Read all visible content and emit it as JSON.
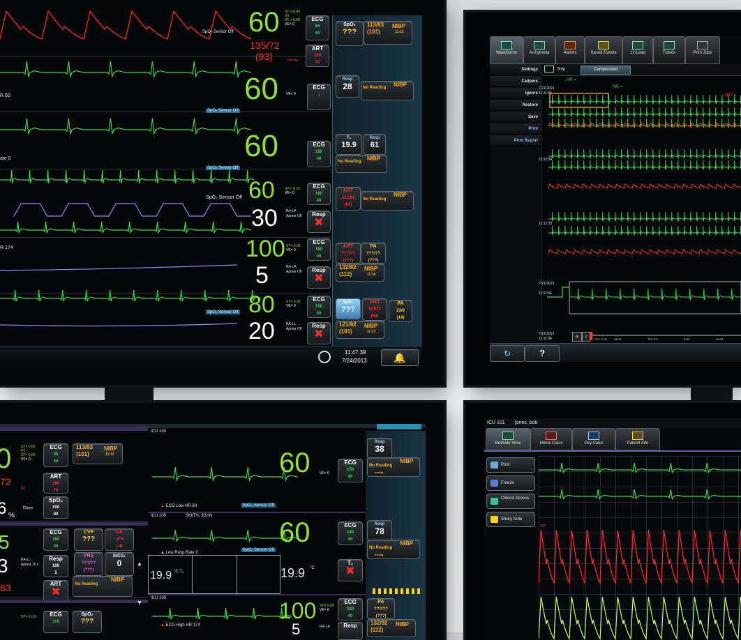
{
  "colors": {
    "ecg": "#3bd64b",
    "hr": "#8fe03a",
    "art": "#ff2b2b",
    "spo2": "#ffffff",
    "resp": "#9a86ff",
    "nibp": "#ffb000",
    "cvp": "#ffd21c"
  },
  "monitor_main": {
    "header": {
      "spo2_sensor_off": "SpO₂ Sensor Off"
    },
    "labels": {
      "hr_60": "R 60",
      "ate_0": "ate 0",
      "hr_174": "R 174"
    },
    "beds": [
      {
        "hr": "60",
        "st_label": "ST ≡ 0.00",
        "st_lead": "V3",
        "ve": "VE= 0",
        "ecg": "ECG",
        "ecg_hi": "85",
        "ecg_lo": "40",
        "art_value": "135/72",
        "art_mean": "(93)",
        "mmhg": "mmHg",
        "art": "ART",
        "art_hi": "160",
        "art_lo": "70",
        "spo2": "SpO₂",
        "spo2_val": "???",
        "nibp_value": "113/83",
        "nibp_mean": "(101)",
        "nibp": "NIBP",
        "nibp_time": "11:10"
      },
      {
        "hr": "60",
        "ve": "VE= 0",
        "ecg": "ECG",
        "resp": "Resp",
        "resp_val": "28",
        "no_reading": "No Reading",
        "nibp": "NIBP",
        "mmhg": "mmHg"
      },
      {
        "hr": "60",
        "ecg": "ECG",
        "t1": "T₁",
        "t1_val": "19.9",
        "resp": "Resp",
        "resp_val": "61",
        "no_reading": "No Reading",
        "nibp": "NIBP",
        "mmhg": "mmHg"
      },
      {
        "hr": "60",
        "rr": "30",
        "st": "ST= -0.16",
        "ve": "VE= 0",
        "ecg": "ECG",
        "lead": "RA-LA",
        "apnea": "Apnea Off",
        "resp": "Resp",
        "art": "ART",
        "art_val": "121/81",
        "art_mean": "(94)",
        "no_reading": "No Reading",
        "nibp": "NIBP",
        "mmhg": "mmHg"
      },
      {
        "hr": "100",
        "rr": "5",
        "st": "ST= 0.08",
        "ve": "VE= 0",
        "ecg": "ECG",
        "lead": "RA-LA",
        "apnea": "Apnea Off",
        "resp": "Resp",
        "art": "ART",
        "art_val": "???/??",
        "art_mean": "(???)",
        "pa": "PA",
        "pa_val": "???/??",
        "pa_mean": "(???)",
        "nibp_val": "132/92",
        "nibp_mean": "(112)",
        "nibp": "NIBP",
        "nibp_time": "11:16"
      },
      {
        "hr": "80",
        "rr": "20",
        "st": "ST= 0.08",
        "ve": "VE= 0",
        "ecg": "ECG",
        "lead": "RA-LL",
        "apnea": "Apnea Off",
        "resp": "Resp",
        "spo2": "SpO₂",
        "spo2_val": "???",
        "art": "ART",
        "art_val": "117/77",
        "art_mean": "(93)",
        "pa": "PA",
        "pa_val": "23/9",
        "pa_mean": "(14)",
        "nibp_val": "121/92",
        "nibp_mean": "(101)",
        "nibp": "NIBP",
        "nibp_time": "11:17"
      }
    ],
    "footer": {
      "time": "11:47:39",
      "date": "7/24/2013"
    }
  },
  "monitor_review": {
    "tabs": [
      "Waveforms",
      "Arrhythmia",
      "Alarms",
      "Saved Events",
      "12-Lead",
      "Trends",
      "Print Jobs"
    ],
    "subtabs": [
      "Strip",
      "Compressed"
    ],
    "buttons": [
      "Settings",
      "Calipers",
      "Ignore",
      "Restore",
      "Save",
      "Print",
      "Print Report"
    ],
    "hr_label": "HR =",
    "rr_label": "RR =",
    "art_label": "ART =",
    "rows": [
      {
        "date": "7/21/2013",
        "time": "11:11:34"
      },
      {
        "date": "",
        "time": "11:12:34"
      },
      {
        "date": "",
        "time": "11:12:33"
      }
    ],
    "strip_date": "7/21/2013",
    "strip_time": "11:11:34",
    "nav_date": "7/21/2013",
    "nav_time": "11:11:34",
    "nav_ticks": [
      "7/21 11:11",
      "16:00",
      "7/22 9:5",
      "8:00",
      "20:00"
    ],
    "help": "?"
  },
  "monitor_central": {
    "left_tiles": {
      "st1": "ST= 0.00",
      "lead": "V3",
      "st2": "ST= 0.00",
      "ve": "VE= 0",
      "ecg": "ECG",
      "ecg_hi": "86",
      "ecg_lo": "40",
      "art_v": "72",
      "art_m": "M",
      "art": "ART",
      "art_hi": "160",
      "art_lo": "70",
      "nibp_val": "113/83",
      "nibp_mean": "(101)",
      "nibp": "NIBP",
      "nibp_time": "11:10",
      "mmhg": "mmHg",
      "spo2": "SpO₂",
      "spo2_hi": "100",
      "spo2_lo": "90",
      "pct": "%",
      "bpm": "72bpm",
      "hr2": "5",
      "ecg2": "ECG",
      "ecg2_hi": "180",
      "ecg2_lo": "40",
      "rr2": "3",
      "lead2": "RA-LL",
      "apnea": "Apnea 15 s",
      "resp": "Resp",
      "resp_hi": "100",
      "resp_lo": "5",
      "cvp": "CVP",
      "cvp_val": "???",
      "prs": "PRS",
      "prs_val": "???/??",
      "prs_mean": "(???)",
      "ua": "UA",
      "ua_val": "-2/-5",
      "ua_mean": "(-4)",
      "etco2": "EtCO₂",
      "etco2_val": "0",
      "no_reading": "No Reading",
      "nibp2": "NIBP",
      "art2": "ART",
      "art_red": "63",
      "spo2b": "SpO₂",
      "spo2b_val": "???",
      "st3": "ST= -0.16",
      "ecg3": "ECG"
    },
    "beds": [
      {
        "name": "ICU 103",
        "patient": "",
        "hr": "60",
        "ve": "VE= 0",
        "ecg": "ECG",
        "alarm": "ECG Low HR 60",
        "sensor": "SpO₂ Sensor Off",
        "resp": "Resp",
        "resp_val": "38",
        "no_reading": "No Reading",
        "nibp": "NIBP",
        "mmhg": "mmHg"
      },
      {
        "name": "ICU 105",
        "patient": "SMITH, JOHN",
        "hr": "60",
        "ecg": "ECG",
        "alarm": "Low Resp Rate 0",
        "sensor": "SpO₂ Sensor Off",
        "t1": "19.9",
        "t1_unit": "°C T₁",
        "t2": "19.9",
        "t2_unit": "°C",
        "resp": "Resp",
        "resp_val": "78",
        "no_reading": "No Reading",
        "nibp": "NIBP",
        "mmhg": "mmHg"
      },
      {
        "name": "ICU 109",
        "patient": "",
        "hr": "100",
        "st": "ST= 0.08",
        "ve": "VE= 0",
        "ecg": "ECG",
        "alarm": "ECG High HR 174",
        "rr": "5",
        "lead": "RA-LA",
        "resp": "Resp",
        "pa": "PA",
        "pa_val": "???/??",
        "pa_mean": "(???)",
        "nibp_val": "132/92",
        "nibp_mean": "(112)",
        "nibp": "NIBP"
      }
    ]
  },
  "monitor_bedside": {
    "title": "ICU 101",
    "patient": "jones, bob",
    "tabs": [
      "Bedside View",
      "Hemo Calcs",
      "Oxy Calcs",
      "Patient Info"
    ],
    "buttons": [
      "Print",
      "Freeze",
      "Clinical Access",
      "Sticky Note"
    ],
    "scale": "137"
  }
}
